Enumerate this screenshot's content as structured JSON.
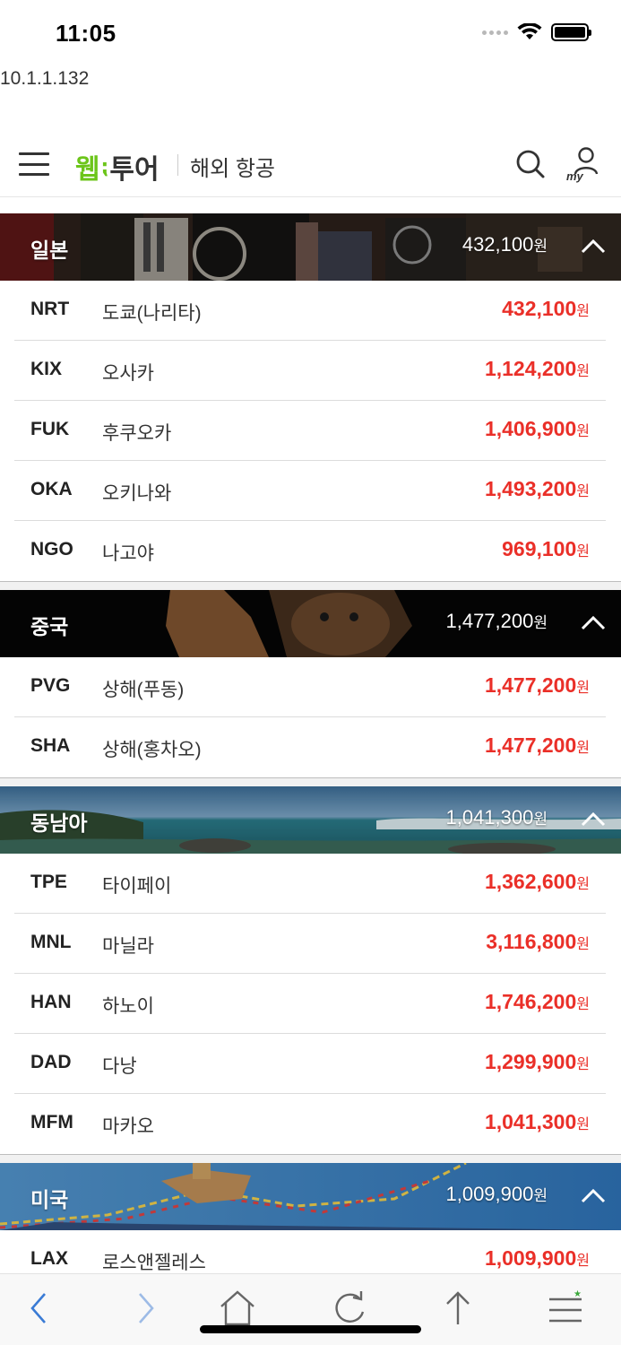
{
  "status_bar": {
    "time": "11:05"
  },
  "browser": {
    "url": "10.1.1.132"
  },
  "header": {
    "logo_web": "웹",
    "logo_tour": "투어",
    "title": "해외 항공"
  },
  "sections": [
    {
      "name": "일본",
      "price": "432,100",
      "currency": "원",
      "routes": [
        {
          "code": "NRT",
          "city": "도쿄(나리타)",
          "price": "432,100",
          "currency": "원"
        },
        {
          "code": "KIX",
          "city": "오사카",
          "price": "1,124,200",
          "currency": "원"
        },
        {
          "code": "FUK",
          "city": "후쿠오카",
          "price": "1,406,900",
          "currency": "원"
        },
        {
          "code": "OKA",
          "city": "오키나와",
          "price": "1,493,200",
          "currency": "원"
        },
        {
          "code": "NGO",
          "city": "나고야",
          "price": "969,100",
          "currency": "원"
        }
      ]
    },
    {
      "name": "중국",
      "price": "1,477,200",
      "currency": "원",
      "routes": [
        {
          "code": "PVG",
          "city": "상해(푸동)",
          "price": "1,477,200",
          "currency": "원"
        },
        {
          "code": "SHA",
          "city": "상해(홍차오)",
          "price": "1,477,200",
          "currency": "원"
        }
      ]
    },
    {
      "name": "동남아",
      "price": "1,041,300",
      "currency": "원",
      "routes": [
        {
          "code": "TPE",
          "city": "타이페이",
          "price": "1,362,600",
          "currency": "원"
        },
        {
          "code": "MNL",
          "city": "마닐라",
          "price": "3,116,800",
          "currency": "원"
        },
        {
          "code": "HAN",
          "city": "하노이",
          "price": "1,746,200",
          "currency": "원"
        },
        {
          "code": "DAD",
          "city": "다낭",
          "price": "1,299,900",
          "currency": "원"
        },
        {
          "code": "MFM",
          "city": "마카오",
          "price": "1,041,300",
          "currency": "원"
        }
      ]
    },
    {
      "name": "미국",
      "price": "1,009,900",
      "currency": "원",
      "routes": [
        {
          "code": "LAX",
          "city": "로스앤젤레스",
          "price": "1,009,900",
          "currency": "원"
        }
      ]
    }
  ],
  "colors": {
    "brand_green": "#6cc51a",
    "price_red": "#ea2f28",
    "toolbar_blue": "#3a7bd5"
  },
  "toolbar_icons": [
    "back-icon",
    "forward-icon",
    "home-icon",
    "reload-icon",
    "share-icon",
    "menu-icon"
  ]
}
